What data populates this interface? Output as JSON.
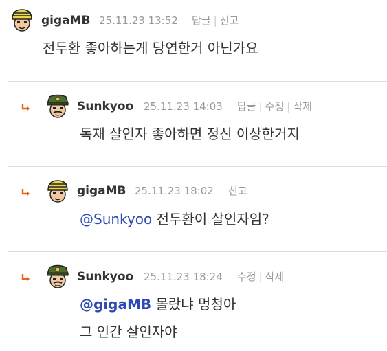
{
  "colors": {
    "mention": "#2e4ab3",
    "reply_arrow": "#e8621a",
    "meta_text": "#999999",
    "divider": "#dcdcdc"
  },
  "comments": [
    {
      "is_reply": false,
      "avatar": "helmet-avatar",
      "author": "gigaMB",
      "date": "25.11.23 13:52",
      "actions": [
        "답글",
        "신고"
      ],
      "mention": "",
      "lines": [
        "전두환 좋아하는게 당연한거 아닌가요"
      ]
    },
    {
      "is_reply": true,
      "avatar": "general-avatar",
      "author": "Sunkyoo",
      "date": "25.11.23 14:03",
      "actions": [
        "답글",
        "수정",
        "삭제"
      ],
      "mention": "",
      "lines": [
        "독재 살인자 좋아하면 정신 이상한거지"
      ]
    },
    {
      "is_reply": true,
      "avatar": "helmet-avatar",
      "author": "gigaMB",
      "date": "25.11.23 18:02",
      "actions": [
        "신고"
      ],
      "mention": "@Sunkyoo",
      "lines": [
        "전두환이 살인자임?"
      ]
    },
    {
      "is_reply": true,
      "avatar": "general-avatar",
      "author": "Sunkyoo",
      "date": "25.11.23 18:24",
      "actions": [
        "수정",
        "삭제"
      ],
      "mention": "@gigaMB",
      "lines": [
        "몰랐냐 멍청아",
        "그 인간 살인자야"
      ]
    }
  ]
}
